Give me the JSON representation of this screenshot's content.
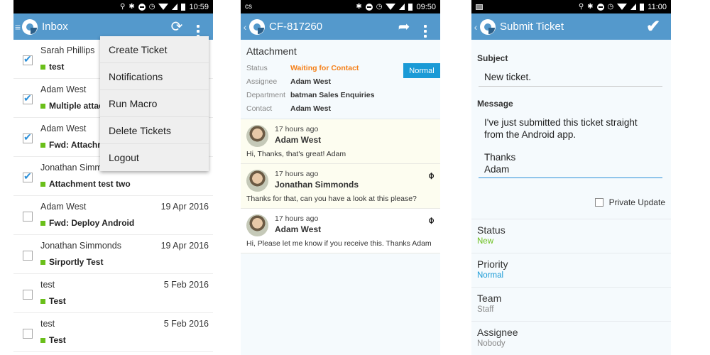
{
  "inbox_screen": {
    "statusbar": {
      "time": "10:59"
    },
    "appbar": {
      "title": "Inbox",
      "menu_icon": "hamburger-icon",
      "refresh_icon": "refresh-icon",
      "overflow_icon": "more-vert-icon"
    },
    "tickets": [
      {
        "sender": "Sarah Phillips",
        "subject": "test",
        "date": "",
        "checked": true
      },
      {
        "sender": "Adam West",
        "subject": "Multiple attac",
        "date": "",
        "checked": true
      },
      {
        "sender": "Adam West",
        "subject": "Fwd: Attachm",
        "date": "",
        "checked": true
      },
      {
        "sender": "Jonathan Simm",
        "subject": "Attachment test two",
        "date": "",
        "checked": true
      },
      {
        "sender": "Adam West",
        "subject": "Fwd: Deploy Android",
        "date": "19 Apr 2016",
        "checked": false
      },
      {
        "sender": "Jonathan Simmonds",
        "subject": "Sirportly Test",
        "date": "19 Apr 2016",
        "checked": false
      },
      {
        "sender": "test",
        "subject": "Test",
        "date": "5 Feb 2016",
        "checked": false
      },
      {
        "sender": "test",
        "subject": "Test",
        "date": "5 Feb 2016",
        "checked": false
      }
    ],
    "overflow_menu": [
      "Create Ticket",
      "Notifications",
      "Run Macro",
      "Delete Tickets",
      "Logout"
    ],
    "tag_color": "#6abf1a"
  },
  "ticket_screen": {
    "statusbar": {
      "left": "cs",
      "time": "09:50"
    },
    "appbar": {
      "title": "CF-817260",
      "reply_icon": "reply-icon",
      "overflow_icon": "more-vert-icon"
    },
    "subject": "Attachment",
    "properties": [
      {
        "key": "Status",
        "value": "Waiting for Contact"
      },
      {
        "key": "Assignee",
        "value": "Adam West"
      },
      {
        "key": "Department",
        "value": "batman Sales Enquiries"
      },
      {
        "key": "Contact",
        "value": "Adam West"
      }
    ],
    "priority": "Normal",
    "messages": [
      {
        "time": "17 hours ago",
        "author": "Adam West",
        "body": "Hi, Thanks, that's great! Adam",
        "attachment": false
      },
      {
        "time": "17 hours ago",
        "author": "Jonathan Simmonds",
        "body": "Thanks for that, can you have a look at this please?",
        "attachment": true
      },
      {
        "time": "17 hours ago",
        "author": "Adam West",
        "body": "Hi, Please let me know if you receive this. Thanks Adam",
        "attachment": true
      }
    ],
    "status_color": "#f57f17",
    "priority_color": "#1a9ad6"
  },
  "submit_screen": {
    "statusbar": {
      "time": "11:00"
    },
    "appbar": {
      "title": "Submit Ticket",
      "confirm_icon": "check-icon"
    },
    "subject_label": "Subject",
    "subject_value": "New ticket.",
    "message_label": "Message",
    "message_line1": "I've just submitted this ticket straight",
    "message_line2": "from the Android app.",
    "message_line3": "Thanks",
    "message_line4": "Adam",
    "private_label": "Private Update",
    "private_checked": false,
    "fields": [
      {
        "key": "Status",
        "value": "New"
      },
      {
        "key": "Priority",
        "value": "Normal"
      },
      {
        "key": "Team",
        "value": "Staff"
      },
      {
        "key": "Assignee",
        "value": "Nobody"
      }
    ]
  }
}
